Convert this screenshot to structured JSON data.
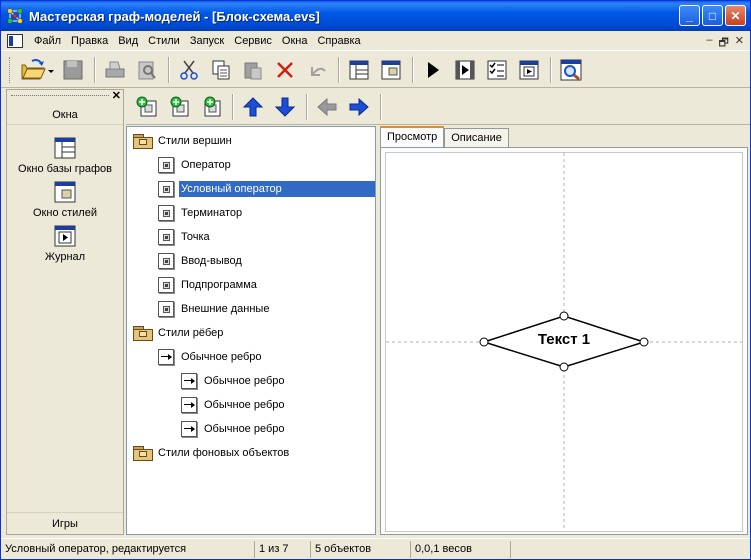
{
  "window": {
    "title": "Мастерская граф-моделей - [Блок-схема.evs]",
    "minimize": "_",
    "maximize": "□",
    "close": "✕"
  },
  "menu": {
    "items": [
      "Файл",
      "Правка",
      "Вид",
      "Стили",
      "Запуск",
      "Сервис",
      "Окна",
      "Справка"
    ],
    "mdi_minimize": "–",
    "mdi_restore": "🗗",
    "mdi_close": "✕"
  },
  "left_panel": {
    "close": "✕",
    "section": "Окна",
    "items": [
      "Окно базы графов",
      "Окно стилей",
      "Журнал"
    ],
    "footer": "Игры"
  },
  "tree": {
    "vertex_folder": "Стили вершин",
    "vertices": [
      "Оператор",
      "Условный оператор",
      "Терминатор",
      "Точка",
      "Ввод-вывод",
      "Подпрограмма",
      "Внешние данные"
    ],
    "selected_vertex": "Условный оператор",
    "edge_folder": "Стили рёбер",
    "edge_root": "Обычное ребро",
    "edge_children": [
      "Обычное ребро",
      "Обычное ребро",
      "Обычное ребро"
    ],
    "background_folder": "Стили фоновых объектов"
  },
  "preview": {
    "tabs": [
      "Просмотр",
      "Описание"
    ],
    "active_tab": "Просмотр",
    "node_text": "Текст 1"
  },
  "status": {
    "message": "Условный оператор, редактируется",
    "position": "1 из 7",
    "objects": "5 объектов",
    "weight": "0,0,1 весов"
  },
  "colors": {
    "selection": "#316ac5",
    "titlebar": "#0058e6",
    "arrow_blue": "#1a4fd6",
    "arrow_gray": "#9a9a9a"
  }
}
